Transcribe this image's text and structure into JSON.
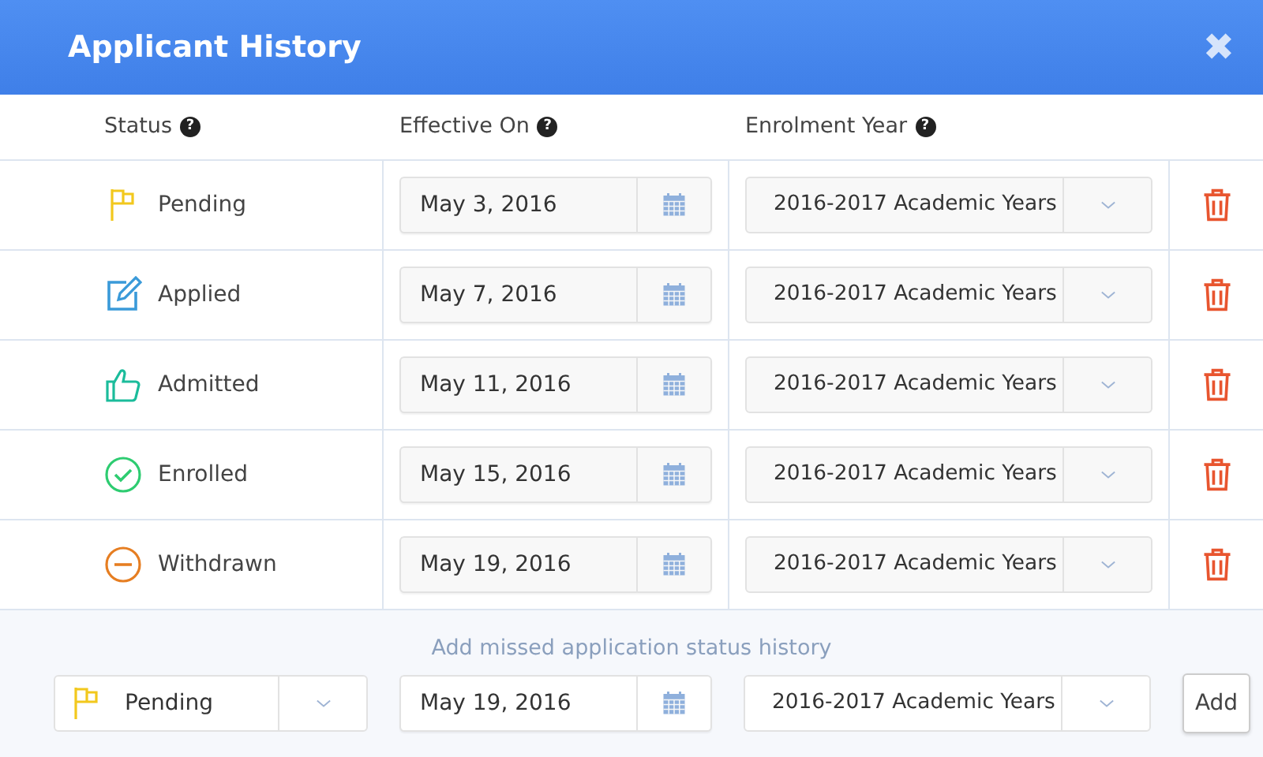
{
  "window": {
    "title": "Applicant History",
    "close": "✖"
  },
  "columns": [
    {
      "label": "Status",
      "help": "?"
    },
    {
      "label": "Effective On",
      "help": "?"
    },
    {
      "label": "Enrolment Year",
      "help": "?"
    }
  ],
  "rows": [
    {
      "status": "Pending",
      "kind": "flag",
      "color": "#f2c81d",
      "date": "May 3, 2016",
      "year": "2016-2017 Academic Years"
    },
    {
      "status": "Applied",
      "kind": "edit",
      "color": "#3a9ad9",
      "date": "May 7, 2016",
      "year": "2016-2017 Academic Years"
    },
    {
      "status": "Admitted",
      "kind": "thumb",
      "color": "#1bbc9b",
      "date": "May 11, 2016",
      "year": "2016-2017 Academic Years"
    },
    {
      "status": "Enrolled",
      "kind": "check",
      "color": "#2ecc71",
      "date": "May 15, 2016",
      "year": "2016-2017 Academic Years"
    },
    {
      "status": "Withdrawn",
      "kind": "minus",
      "color": "#e67e22",
      "date": "May 19, 2016",
      "year": "2016-2017 Academic Years"
    }
  ],
  "add_form": {
    "hint": "Add missed application status history",
    "status": "Pending",
    "kind": "flag",
    "color": "#f2c81d",
    "date": "May 19, 2016",
    "year": "2016-2017 Academic Years",
    "button": "Add"
  }
}
